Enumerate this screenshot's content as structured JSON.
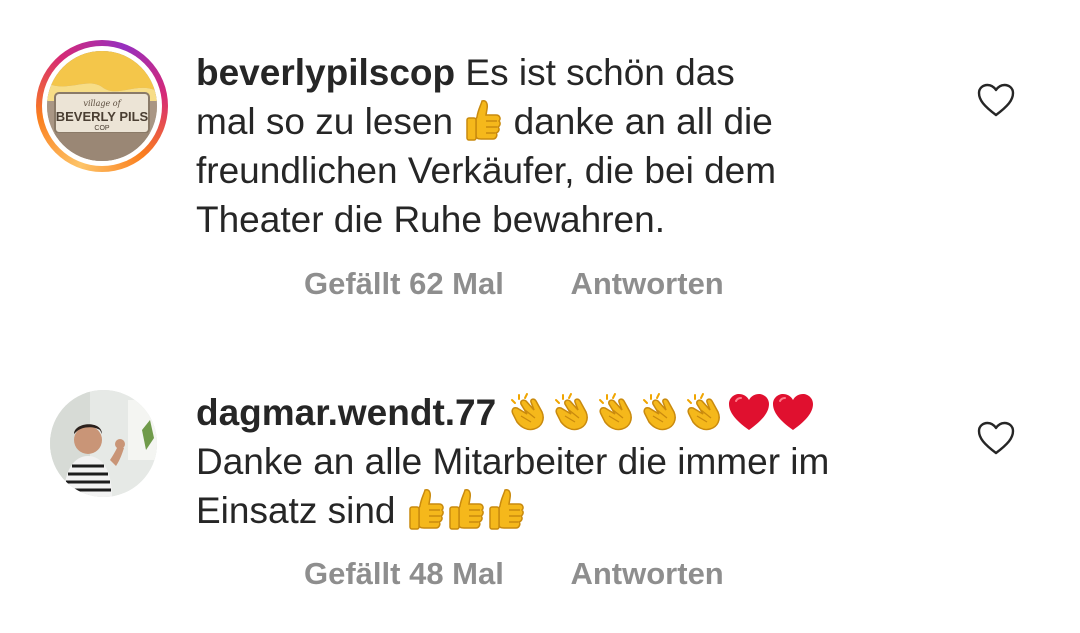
{
  "comments": [
    {
      "username": "beverlypilscop",
      "text_lines": [
        "Es ist schön das",
        "mal so zu lesen",
        "danke an all die",
        "freundlichen Verkäufer, die bei dem",
        "Theater die Ruhe bewahren."
      ],
      "likes_label": "Gefällt 62 Mal",
      "reply_label": "Antworten",
      "avatar": {
        "kind": "logo",
        "logo_text_top": "village of",
        "logo_text_main": "BEVERLY PILS",
        "logo_text_bottom": "COP",
        "story_ring": true
      },
      "emojis": [
        "thumbs-up"
      ]
    },
    {
      "username": "dagmar.wendt.77",
      "text_lines": [
        "Danke an alle Mitarbeiter die immer im",
        "Einsatz sind"
      ],
      "likes_label": "Gefällt 48 Mal",
      "reply_label": "Antworten",
      "avatar": {
        "kind": "photo",
        "story_ring": false
      },
      "emojis_after_username": [
        "clapping-hands",
        "clapping-hands",
        "clapping-hands",
        "clapping-hands",
        "clapping-hands",
        "red-heart",
        "red-heart"
      ],
      "emojis_after_text": [
        "thumbs-up",
        "thumbs-up",
        "thumbs-up"
      ]
    }
  ],
  "colors": {
    "text": "#262626",
    "meta": "#8e8e8e",
    "emoji_yellow": "#f5b81b",
    "heart_red": "#e0102f"
  }
}
